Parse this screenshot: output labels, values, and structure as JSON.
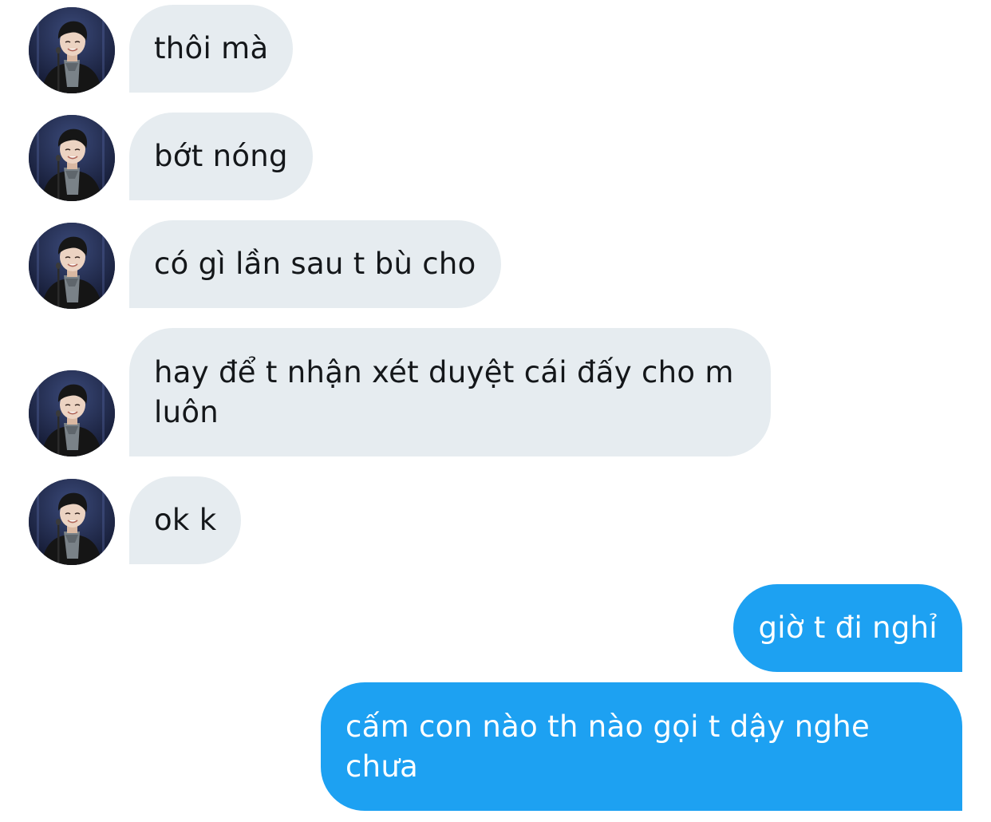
{
  "conversation": {
    "messages": [
      {
        "direction": "incoming",
        "text": "thôi mà",
        "avatar": "contact-avatar"
      },
      {
        "direction": "incoming",
        "text": "bớt nóng",
        "avatar": "contact-avatar"
      },
      {
        "direction": "incoming",
        "text": "có gì lần sau t bù cho",
        "avatar": "contact-avatar"
      },
      {
        "direction": "incoming",
        "text": "hay để t nhận xét duyệt cái đấy cho m luôn",
        "avatar": "contact-avatar"
      },
      {
        "direction": "incoming",
        "text": "ok k",
        "avatar": "contact-avatar"
      },
      {
        "direction": "outgoing",
        "text": "giờ t đi nghỉ"
      },
      {
        "direction": "outgoing",
        "text": "cấm con nào th nào gọi t dậy nghe chưa"
      }
    ]
  },
  "colors": {
    "incoming_bubble": "#e6ecf0",
    "incoming_text": "#14171a",
    "outgoing_bubble": "#1da1f2",
    "outgoing_text": "#ffffff"
  }
}
